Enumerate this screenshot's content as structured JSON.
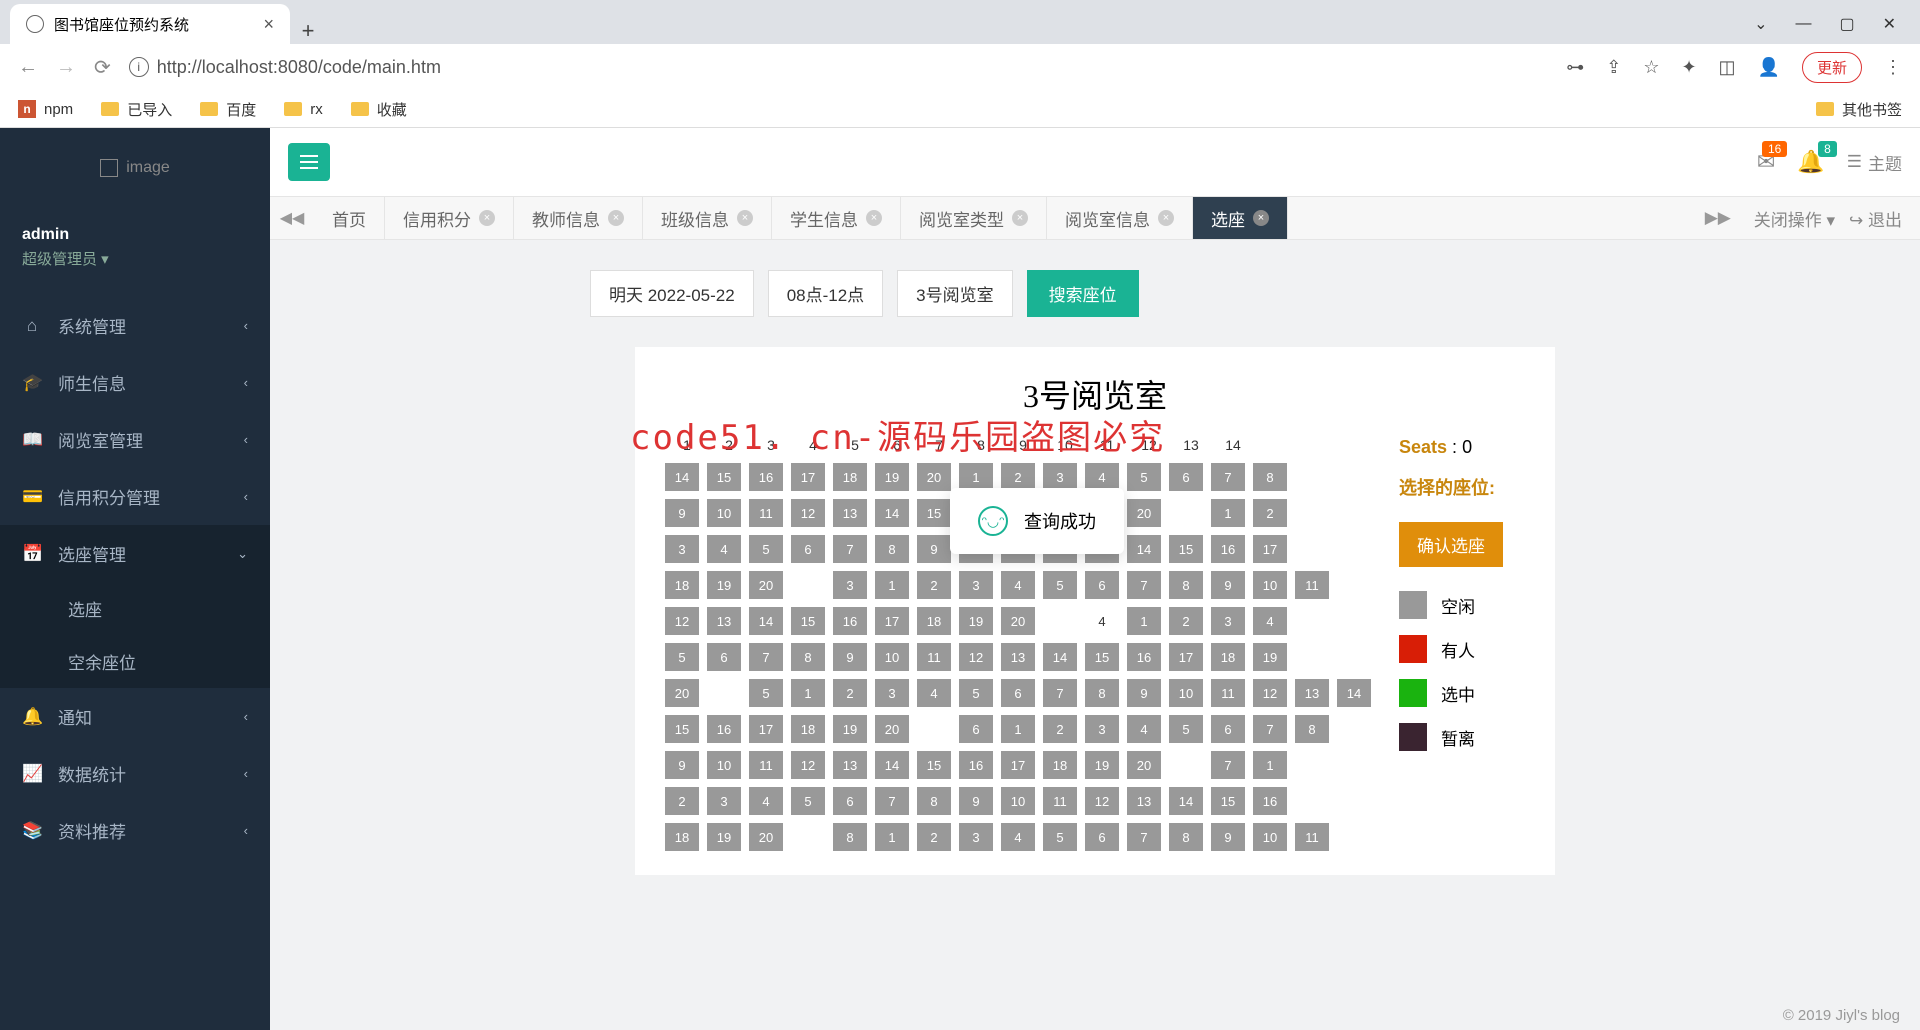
{
  "browser": {
    "tab_title": "图书馆座位预约系统",
    "url": "http://localhost:8080/code/main.htm",
    "update_label": "更新",
    "bookmarks": [
      "npm",
      "已导入",
      "百度",
      "rx",
      "收藏"
    ],
    "other_bookmarks": "其他书签"
  },
  "sidebar": {
    "logo_text": "image",
    "user_name": "admin",
    "user_role": "超级管理员",
    "items": [
      {
        "icon": "⌂",
        "label": "系统管理"
      },
      {
        "icon": "🎓",
        "label": "师生信息"
      },
      {
        "icon": "📖",
        "label": "阅览室管理"
      },
      {
        "icon": "💳",
        "label": "信用积分管理"
      },
      {
        "icon": "📅",
        "label": "选座管理",
        "expanded": true,
        "children": [
          "选座",
          "空余座位"
        ]
      },
      {
        "icon": "🔔",
        "label": "通知"
      },
      {
        "icon": "📈",
        "label": "数据统计"
      },
      {
        "icon": "📚",
        "label": "资料推荐"
      }
    ]
  },
  "topbar": {
    "badge1": "16",
    "badge2": "8",
    "theme_label": "主题"
  },
  "tabstrip": {
    "tabs": [
      {
        "label": "首页",
        "closable": false
      },
      {
        "label": "信用积分",
        "closable": true
      },
      {
        "label": "教师信息",
        "closable": true
      },
      {
        "label": "班级信息",
        "closable": true
      },
      {
        "label": "学生信息",
        "closable": true
      },
      {
        "label": "阅览室类型",
        "closable": true
      },
      {
        "label": "阅览室信息",
        "closable": true
      },
      {
        "label": "选座",
        "closable": true,
        "active": true
      }
    ],
    "close_ops": "关闭操作",
    "logout": "退出"
  },
  "filters": {
    "date": "明天 2022-05-22",
    "time": "08点-12点",
    "room": "3号阅览室",
    "search_label": "搜索座位"
  },
  "room": {
    "title": "3号阅览室",
    "columns": [
      "1",
      "2",
      "3",
      "4",
      "5",
      "6",
      "7",
      "8",
      "9",
      "10",
      "11",
      "12",
      "13",
      "14"
    ],
    "rows": [
      [
        "14",
        "15",
        "16",
        "17",
        "18",
        "19",
        "20",
        "1",
        "2",
        "3",
        "4",
        "5",
        "6",
        "7",
        "8"
      ],
      [
        "9",
        "10",
        "11",
        "12",
        "13",
        "14",
        "15",
        "16",
        "17",
        "18",
        "19",
        "20",
        "",
        "1",
        "2"
      ],
      [
        "3",
        "4",
        "5",
        "6",
        "7",
        "8",
        "9",
        "10",
        "11",
        "12",
        "13",
        "14",
        "15",
        "16",
        "17"
      ],
      [
        "18",
        "19",
        "20",
        "",
        "3",
        "1",
        "2",
        "3",
        "4",
        "5",
        "6",
        "7",
        "8",
        "9",
        "10",
        "11"
      ],
      [
        "12",
        "13",
        "14",
        "15",
        "16",
        "17",
        "18",
        "19",
        "20",
        "",
        "4",
        "1",
        "2",
        "3",
        "4"
      ],
      [
        "5",
        "6",
        "7",
        "8",
        "9",
        "10",
        "11",
        "12",
        "13",
        "14",
        "15",
        "16",
        "17",
        "18",
        "19"
      ],
      [
        "20",
        "",
        "5",
        "1",
        "2",
        "3",
        "4",
        "5",
        "6",
        "7",
        "8",
        "9",
        "10",
        "11",
        "12",
        "13",
        "14"
      ],
      [
        "15",
        "16",
        "17",
        "18",
        "19",
        "20",
        "",
        "6",
        "1",
        "2",
        "3",
        "4",
        "5",
        "6",
        "7",
        "8"
      ],
      [
        "9",
        "10",
        "11",
        "12",
        "13",
        "14",
        "15",
        "16",
        "17",
        "18",
        "19",
        "20",
        "",
        "7",
        "1"
      ],
      [
        "2",
        "3",
        "4",
        "5",
        "6",
        "7",
        "8",
        "9",
        "10",
        "11",
        "12",
        "13",
        "14",
        "15",
        "16"
      ],
      [
        "18",
        "19",
        "20",
        "",
        "8",
        "1",
        "2",
        "3",
        "4",
        "5",
        "6",
        "7",
        "8",
        "9",
        "10",
        "11"
      ]
    ]
  },
  "info_panel": {
    "seats_label": "Seats",
    "seats_count": "0",
    "select_label": "选择的座位:",
    "confirm_label": "确认选座",
    "legend": [
      {
        "color": "#999999",
        "label": "空闲"
      },
      {
        "color": "#d81e06",
        "label": "有人"
      },
      {
        "color": "#1ab30f",
        "label": "选中"
      },
      {
        "color": "#3a2430",
        "label": "暂离"
      }
    ]
  },
  "toast": "查询成功",
  "watermark": "code51. cn-源码乐园盗图必究",
  "footer": "© 2019 Jiyl's blog"
}
